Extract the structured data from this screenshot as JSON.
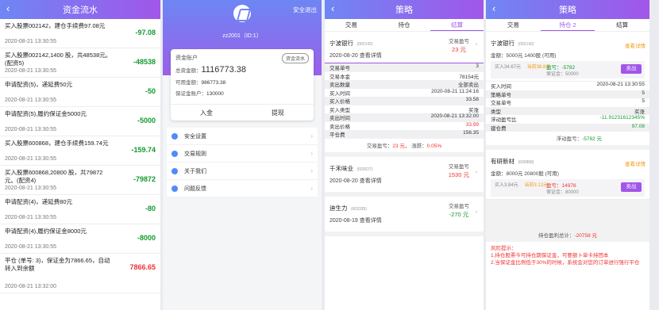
{
  "p1": {
    "title": "资金流水",
    "rows": [
      {
        "text": "买入股票002142，建仓手续费97.08元",
        "date": "2020-08-21 13:30:55",
        "amount": "-97.08",
        "type": "neg"
      },
      {
        "text": "买入股票002142,1400 股，共48538元。(配资5)",
        "date": "2020-08-21 13:30:55",
        "amount": "-48538",
        "type": "neg"
      },
      {
        "text": "申请配资(5)，递延费50元",
        "date": "2020-08-21 13:30:55",
        "amount": "-50",
        "type": "neg"
      },
      {
        "text": "申请配资(5),履约保证金5000元",
        "date": "2020-08-21 13:30:55",
        "amount": "-5000",
        "type": "neg"
      },
      {
        "text": "买入股票600868，建仓手续费159.74元",
        "date": "2020-08-21 13:30:55",
        "amount": "-159.74",
        "type": "neg"
      },
      {
        "text": "买入股票600868,20800 股，共79872元。(配资4)",
        "date": "2020-08-21 13:30:55",
        "amount": "-79872",
        "type": "neg"
      },
      {
        "text": "申请配资(4)，递延费80元",
        "date": "2020-08-21 13:30:55",
        "amount": "-80",
        "type": "neg"
      },
      {
        "text": "申请配资(4),履约保证金8000元",
        "date": "2020-08-21 13:30:55",
        "amount": "-8000",
        "type": "neg"
      },
      {
        "text": "平仓 (单号: 3)，保证金为7866.65，自动转入到余额",
        "date": "2020-08-21 13:32:00",
        "amount": "7866.65",
        "type": "pos"
      }
    ]
  },
  "p2": {
    "exit": "安全退出",
    "user": "zz2001（ID:1）",
    "account_label": "资金账户",
    "records_button": "资金流水",
    "total_label": "总资金额：",
    "total": "1116773.38",
    "avail_label": "可用金额：",
    "avail": "986773.38",
    "margin_label": "保证金账户：",
    "margin": "130000",
    "deposit": "入金",
    "withdraw": "提现",
    "menu": [
      "安全设置",
      "交易规则",
      "关于我们",
      "问题反馈"
    ]
  },
  "p3": {
    "title": "策略",
    "tabs": [
      "交易",
      "持仓",
      "结算"
    ],
    "first": {
      "name": "宁波银行",
      "code": "(002142)",
      "date": "2020-08-20 查看详情",
      "profit_label": "交易盈亏",
      "profit": "23 元"
    },
    "details": [
      [
        "交易单号",
        "3"
      ],
      [
        "交易本金",
        "78154元"
      ],
      [
        "卖出数量",
        "全部卖出"
      ],
      [
        "买入时间",
        "2020-08-21 11:24:16"
      ],
      [
        "买入价格",
        "33.58"
      ],
      [
        "买入类型",
        "买涨"
      ],
      [
        "卖出时间",
        "2020-08-21 13:32:00"
      ],
      [
        "卖出价格",
        "33.99"
      ],
      [
        "平仓费",
        "156.35"
      ]
    ],
    "summary_a": "交易盈亏：",
    "summary_b": "23 元，",
    "summary_c": "涨跌：",
    "summary_d": "0.05%",
    "others": [
      {
        "name": "千禾味业",
        "code": "(603027)",
        "date": "2020-08-20 查看详情",
        "profit_label": "交易盈亏",
        "profit": "1530 元"
      },
      {
        "name": "迪生力",
        "code": "(603335)",
        "date": "2020-08-19 查看详情",
        "profit_label": "交易盈亏",
        "profit": "-270 元"
      }
    ]
  },
  "p4": {
    "title": "策略",
    "tabs": [
      "交易",
      "持仓 2",
      "结算"
    ],
    "detail_link": "查看详情",
    "h1": {
      "name": "宁波银行",
      "code": "(002142)",
      "line": "金额：5000元 1400股 (可用)",
      "buy": "买入34.67元",
      "now": "当前38.8元",
      "pl": "盈亏：-5782",
      "margin": "保证金：50000",
      "sell": "卖出"
    },
    "rows": [
      [
        "买入时间",
        "2020-08-21 13:30:55"
      ],
      [
        "策略单号",
        "5"
      ],
      [
        "交易单号",
        "5"
      ],
      [
        "类型",
        "买涨"
      ],
      [
        "浮动盈亏比",
        "-11.91231612345%"
      ],
      [
        "建仓费",
        "97.08"
      ]
    ],
    "float_label": "浮动盈亏：",
    "float_value": "-5782 元",
    "h2": {
      "name": "有研新材",
      "code": "(600868)",
      "line": "金额：8000元 20800股 (可用)",
      "buy": "买入3.84元",
      "now": "当前3.12元",
      "pl": "盈亏：14976",
      "margin": "保证金：80000",
      "sell": "卖出"
    },
    "total_label": "持仓盈利总计：",
    "total_value": "-20758 元",
    "risk_title": "风险提示：",
    "risk1": "1.持仓股票今可持仓期保证金，可要额卜单卡持团本",
    "risk2": "2.当保证金比例低于30%的时候，系统会对您的订单进行强行平仓"
  },
  "colors": {
    "accent": "#a156ea",
    "up": "#e33333",
    "down": "#129a2e",
    "orange": "#f39c12"
  }
}
